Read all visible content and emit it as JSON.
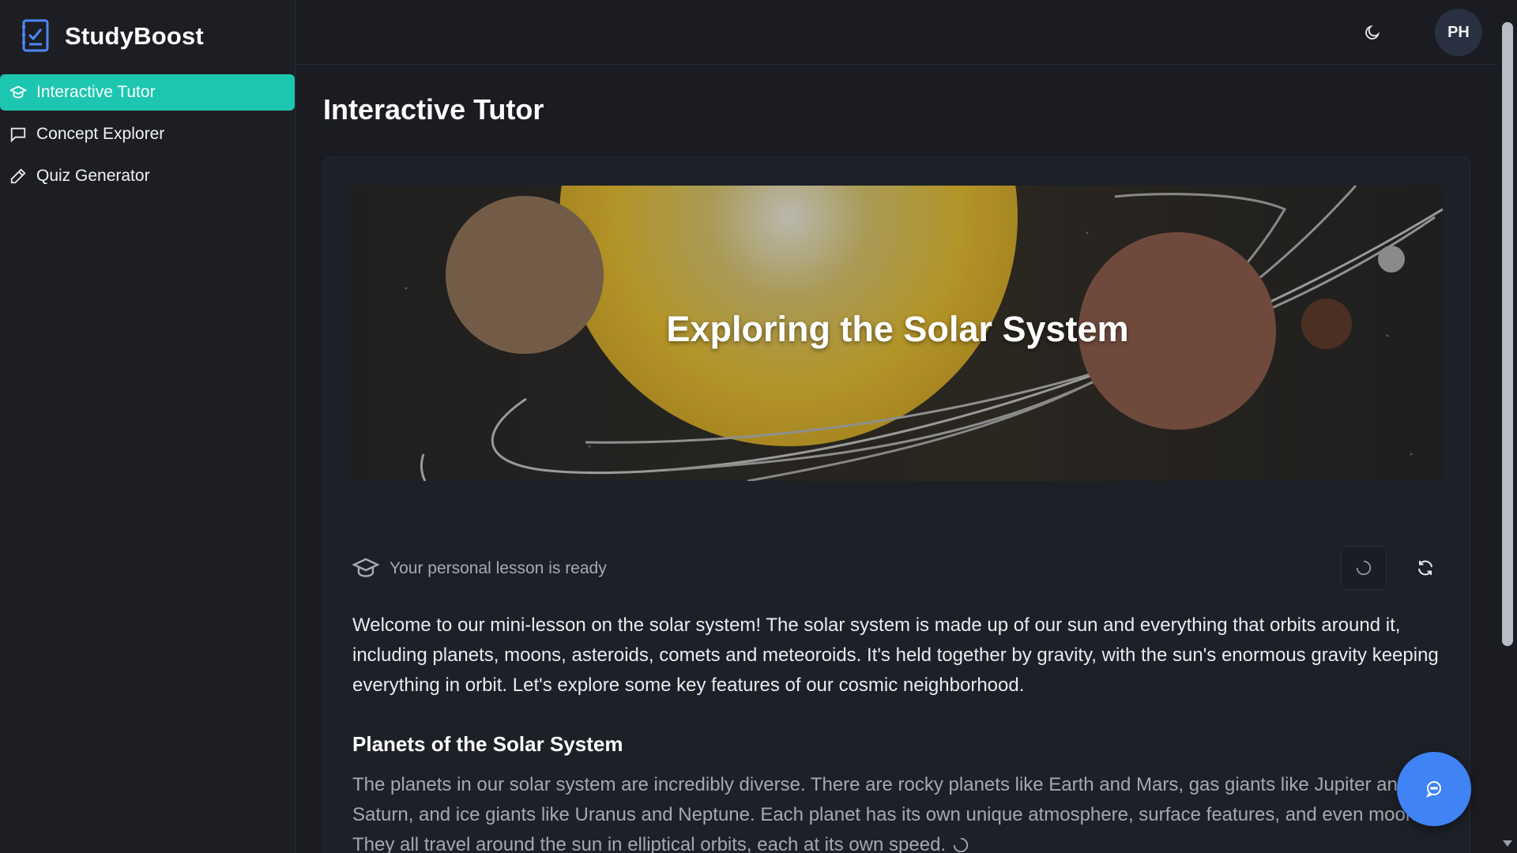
{
  "app": {
    "name": "StudyBoost",
    "accent": "#1cc6b0",
    "fab_color": "#3f83f5"
  },
  "sidebar": {
    "items": [
      {
        "label": "Interactive Tutor",
        "icon": "graduation-cap-icon",
        "active": true
      },
      {
        "label": "Concept Explorer",
        "icon": "chat-bubble-icon",
        "active": false
      },
      {
        "label": "Quiz Generator",
        "icon": "pencil-icon",
        "active": false
      }
    ]
  },
  "header": {
    "theme_icon": "moon-icon",
    "avatar_initials": "PH"
  },
  "main": {
    "title": "Interactive Tutor",
    "hero_title": "Exploring the Solar System",
    "status_text": "Your personal lesson is ready",
    "intro": "Welcome to our mini-lesson on the solar system! The solar system is made up of our sun and everything that orbits around it, including planets, moons, asteroids, comets and meteoroids. It's held together by gravity, with the sun's enormous gravity keeping everything in orbit. Let's explore some key features of our cosmic neighborhood.",
    "section_heading": "Planets of the Solar System",
    "section_body": "The planets in our solar system are incredibly diverse. There are rocky planets like Earth and Mars, gas giants like Jupiter and Saturn, and ice giants like Uranus and Neptune. Each planet has its own unique atmosphere, surface features, and even moons! They all travel around the sun in elliptical orbits, each at its own speed."
  }
}
